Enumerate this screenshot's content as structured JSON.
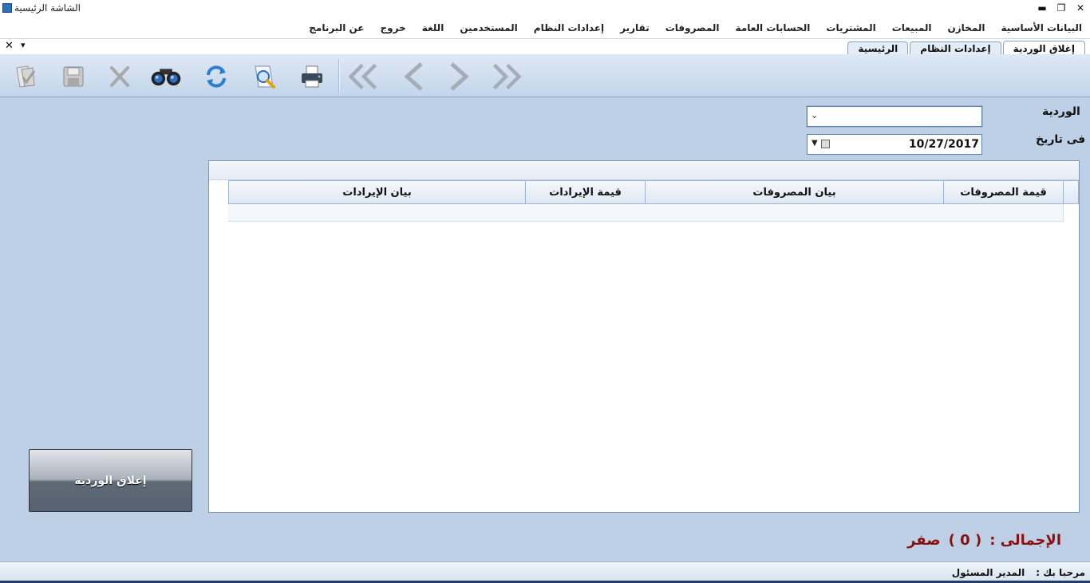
{
  "window": {
    "title": "الشاشة الرئيسية",
    "minimize": "▬",
    "restore": "❐",
    "close": "✕"
  },
  "menu": [
    "البيانات الأساسية",
    "المخازن",
    "المبيعات",
    "المشتريات",
    "الحسابات العامة",
    "المصروفات",
    "تقارير",
    "إعدادات النظام",
    "المستخدمين",
    "اللغة",
    "خروج",
    "عن البرنامج"
  ],
  "mdi": {
    "close": "✕",
    "menu": "▾"
  },
  "tabs": [
    {
      "label": "إغلاق الوردية",
      "active": true
    },
    {
      "label": "إعدادات النظام",
      "active": false
    },
    {
      "label": "الرئيسية",
      "active": false
    }
  ],
  "toolbar": {
    "icons": [
      "approve-icon",
      "save-icon",
      "delete-icon",
      "search-binoculars-icon",
      "refresh-icon",
      "preview-icon",
      "print-icon",
      "first-record-icon",
      "previous-record-icon",
      "next-record-icon",
      "last-record-icon"
    ]
  },
  "form": {
    "shift_label": "الوردية",
    "shift_value": "",
    "date_label": "فى تاريخ",
    "date_value": "10/27/2017"
  },
  "grid": {
    "columns": [
      "قيمة المصروفات",
      "بيان المصروفات",
      "قيمة الإيرادات",
      "بيان الإيرادات"
    ]
  },
  "close_shift_button": "إغلاق الوردية",
  "total": {
    "label": "الإجمالى :",
    "value": "( 0 )",
    "words": "صفر"
  },
  "status": {
    "welcome_label": "مرحبا بك :",
    "user": "المدير المسئول"
  },
  "colors": {
    "background": "#bdd0e6",
    "total_text": "#8b0f0f",
    "button_dark": "#566270"
  }
}
